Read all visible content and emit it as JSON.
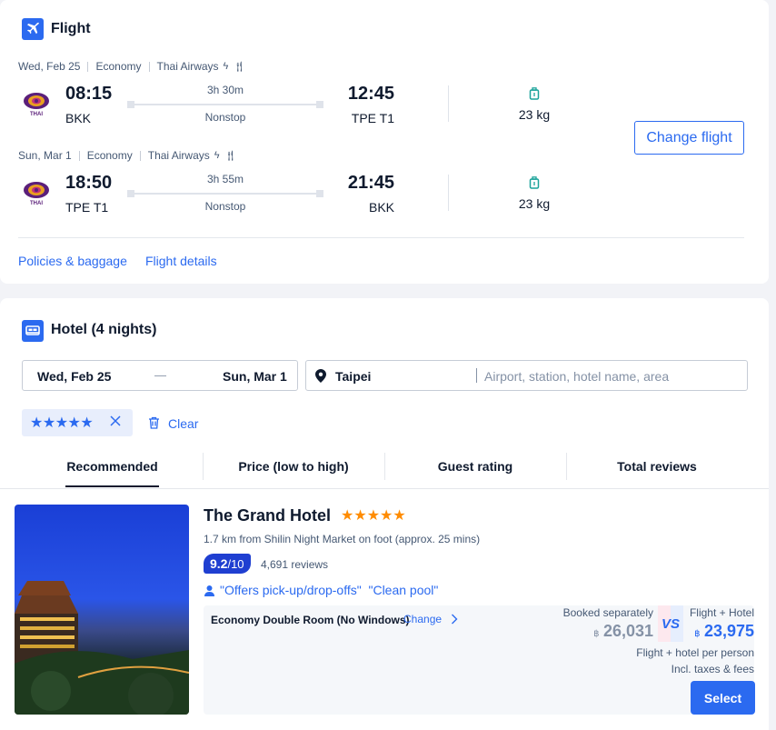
{
  "flight": {
    "title": "Flight",
    "legs": [
      {
        "date": "Wed, Feb 25",
        "cabin": "Economy",
        "airline": "Thai Airways",
        "airline_logo_text": "THAI",
        "dep_time": "08:15",
        "dep_code": "BKK",
        "duration": "3h 30m",
        "stops": "Nonstop",
        "arr_time": "12:45",
        "arr_code": "TPE T1",
        "baggage": "23 kg"
      },
      {
        "date": "Sun, Mar 1",
        "cabin": "Economy",
        "airline": "Thai Airways",
        "airline_logo_text": "THAI",
        "dep_time": "18:50",
        "dep_code": "TPE T1",
        "duration": "3h 55m",
        "stops": "Nonstop",
        "arr_time": "21:45",
        "arr_code": "BKK",
        "baggage": "23 kg"
      }
    ],
    "change_label": "Change flight",
    "policies_label": "Policies & baggage",
    "details_label": "Flight details"
  },
  "hotel": {
    "title": "Hotel (4 nights)",
    "checkin": "Wed, Feb 25",
    "dash": "—",
    "checkout": "Sun, Mar 1",
    "city": "Taipei",
    "search_placeholder": "Airport, station, hotel name, area",
    "filter_stars": "★★★★★",
    "clear_label": "Clear"
  },
  "sort_tabs": [
    "Recommended",
    "Price (low to high)",
    "Guest rating",
    "Total reviews"
  ],
  "result": {
    "name": "The Grand Hotel",
    "stars": "★★★★★",
    "distance": "1.7 km from Shilin Night Market on foot (approx. 25 mins)",
    "rating": "9.2",
    "rating_max": "/10",
    "reviews": "4,691 reviews",
    "highlights": "\"Offers pick-up/drop-offs\"  \"Clean pool\"",
    "room": "Economy Double Room (No Windows)",
    "change_label": "Change",
    "separate_label": "Booked separately",
    "separate_currency": "฿",
    "separate_price": "26,031",
    "vs_label": "VS",
    "bundle_label": "Flight + Hotel",
    "bundle_currency": "฿",
    "bundle_price": "23,975",
    "per_person": "Flight + hotel per person",
    "taxes": "Incl. taxes & fees",
    "select_label": "Select"
  },
  "colors": {
    "accent": "#2b6af0",
    "star": "#ff8c00",
    "thai_purple": "#5b1f7a",
    "thai_gold": "#e8a020",
    "rating_badge": "#1f3fd1"
  }
}
